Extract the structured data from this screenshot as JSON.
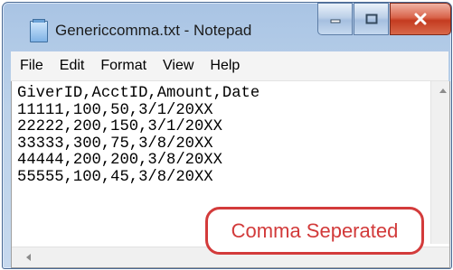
{
  "window": {
    "title": "Genericcomma.txt - Notepad"
  },
  "menu": [
    "File",
    "Edit",
    "Format",
    "View",
    "Help"
  ],
  "editor": {
    "lines": [
      "GiverID,AcctID,Amount,Date",
      "11111,100,50,3/1/20XX",
      "22222,200,150,3/1/20XX",
      "33333,300,75,3/8/20XX",
      "44444,200,200,3/8/20XX",
      "55555,100,45,3/8/20XX"
    ]
  },
  "callout": {
    "text": "Comma Seperated"
  },
  "colors": {
    "callout": "#d23a3a",
    "close_button": "#c43b20",
    "titlebar": "#bcd2ea"
  },
  "icons": [
    "notepad-icon",
    "minimize-icon",
    "maximize-icon",
    "close-icon",
    "scroll-up-arrow-icon",
    "scroll-left-arrow-icon"
  ]
}
